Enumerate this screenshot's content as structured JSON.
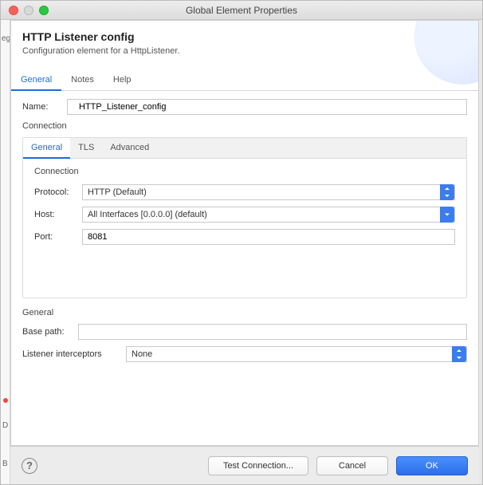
{
  "window": {
    "title": "Global Element Properties"
  },
  "header": {
    "heading": "HTTP Listener config",
    "subheading": "Configuration element for a HttpListener."
  },
  "tabs": [
    "General",
    "Notes",
    "Help"
  ],
  "active_tab": 0,
  "name_field": {
    "label": "Name:",
    "value": "HTTP_Listener_config"
  },
  "connection_section": {
    "label": "Connection",
    "inner_tabs": [
      "General",
      "TLS",
      "Advanced"
    ],
    "inner_active": 0,
    "sub_title": "Connection",
    "fields": {
      "protocol": {
        "label": "Protocol:",
        "value": "HTTP (Default)"
      },
      "host": {
        "label": "Host:",
        "value": "All Interfaces [0.0.0.0] (default)"
      },
      "port": {
        "label": "Port:",
        "value": "8081"
      }
    }
  },
  "general_section": {
    "label": "General",
    "base_path": {
      "label": "Base path:",
      "value": ""
    },
    "interceptors": {
      "label": "Listener interceptors",
      "value": "None"
    }
  },
  "buttons": {
    "test": "Test Connection...",
    "cancel": "Cancel",
    "ok": "OK"
  },
  "left_hints": {
    "top": "eg",
    "d": "D",
    "b": "B"
  }
}
